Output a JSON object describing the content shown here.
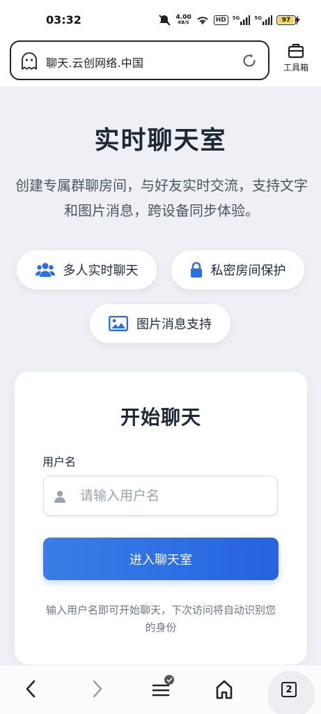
{
  "status_bar": {
    "time": "03:32",
    "net_speed_value": "4.00",
    "net_speed_unit": "KB/S",
    "hd_label": "HD",
    "signal_1_label": "5G",
    "signal_2_label": "5G",
    "battery_level": "97"
  },
  "browser": {
    "url": "聊天.云创网络.中国",
    "toolbox_label": "工具箱",
    "tab_count": "2"
  },
  "hero": {
    "title": "实时聊天室",
    "description": "创建专属群聊房间，与好友实时交流，支持文字和图片消息，跨设备同步体验。"
  },
  "features": [
    {
      "label": "多人实时聊天",
      "icon": "users-icon"
    },
    {
      "label": "私密房间保护",
      "icon": "lock-icon"
    },
    {
      "label": "图片消息支持",
      "icon": "image-icon"
    }
  ],
  "login": {
    "title": "开始聊天",
    "username_label": "用户名",
    "username_placeholder": "请输入用户名",
    "username_value": "",
    "submit_label": "进入聊天室",
    "hint": "输入用户名即可开始聊天，下次访问将自动识别您的身份"
  },
  "colors": {
    "accent": "#2563e0",
    "page_bg": "#eef0f5",
    "icon_blue": "#2b6fe0"
  }
}
